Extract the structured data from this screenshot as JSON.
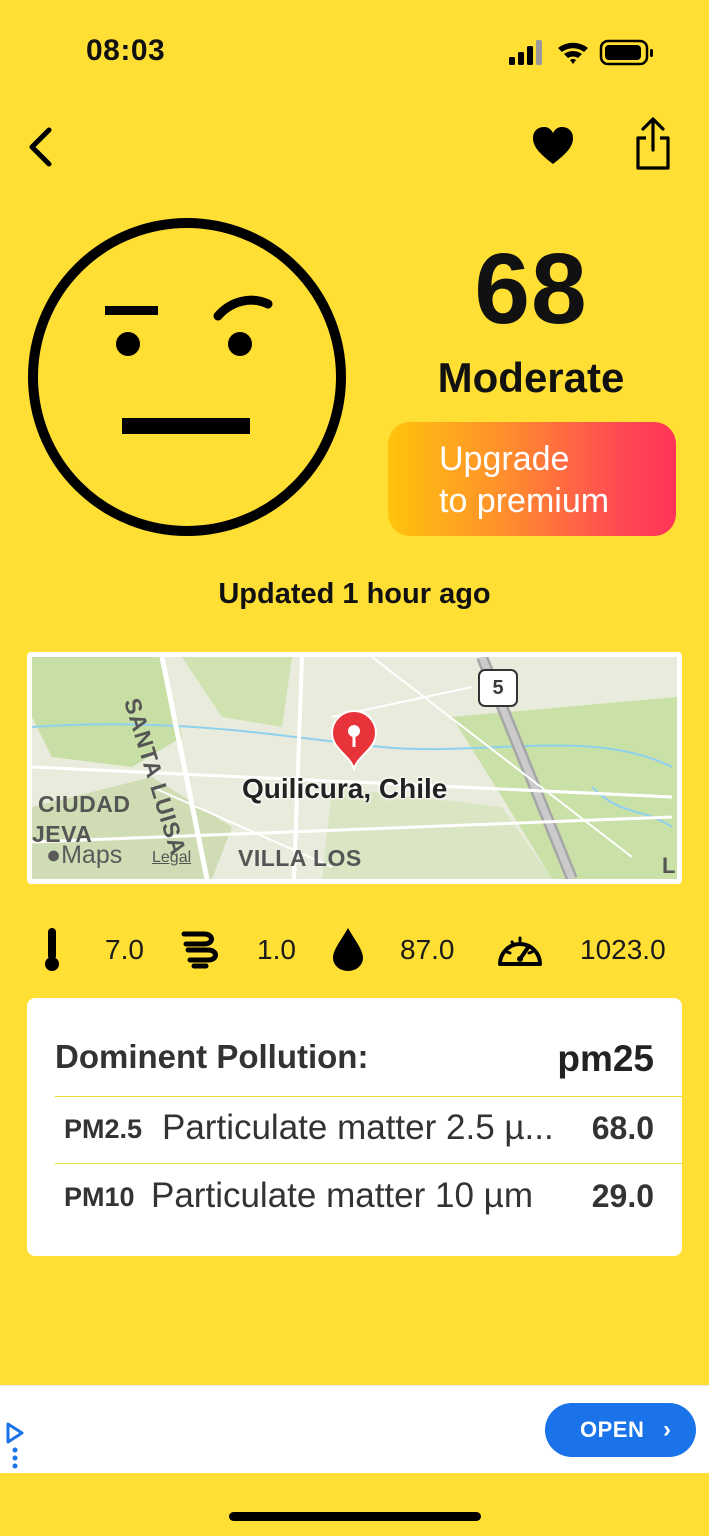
{
  "status_bar": {
    "time": "08:03"
  },
  "nav": {
    "back_icon": "chevron-left",
    "favorite_icon": "heart",
    "share_icon": "share"
  },
  "aqi": {
    "value": "68",
    "level": "Moderate",
    "face_icon": "skeptical-face",
    "upgrade_line1": "Upgrade",
    "upgrade_line2": "to premium",
    "updated": "Updated 1 hour ago"
  },
  "map": {
    "location": "Quilicura, Chile",
    "labels": {
      "santa": "SANTA LUISA",
      "ciudad": "CIUDAD",
      "jeva": "JEVA",
      "villa": "VILLA LOS",
      "route": "5",
      "edge": "L"
    },
    "brand": "Maps",
    "legal": "Legal"
  },
  "weather": {
    "temperature": "7.0",
    "wind": "1.0",
    "humidity": "87.0",
    "pressure": "1023.0"
  },
  "pollution": {
    "title": "Dominent Pollution:",
    "dominant": "pm25",
    "items": [
      {
        "code": "PM2.5",
        "name": "Particulate matter 2.5 µ...",
        "value": "68.0"
      },
      {
        "code": "PM10",
        "name": "Particulate matter 10 µm",
        "value": "29.0"
      }
    ]
  },
  "ad": {
    "button": "OPEN"
  },
  "colors": {
    "background": "#FFDF33",
    "accent_start": "#FFC40C",
    "accent_end": "#FF3358",
    "ad_button": "#1A73E8"
  }
}
